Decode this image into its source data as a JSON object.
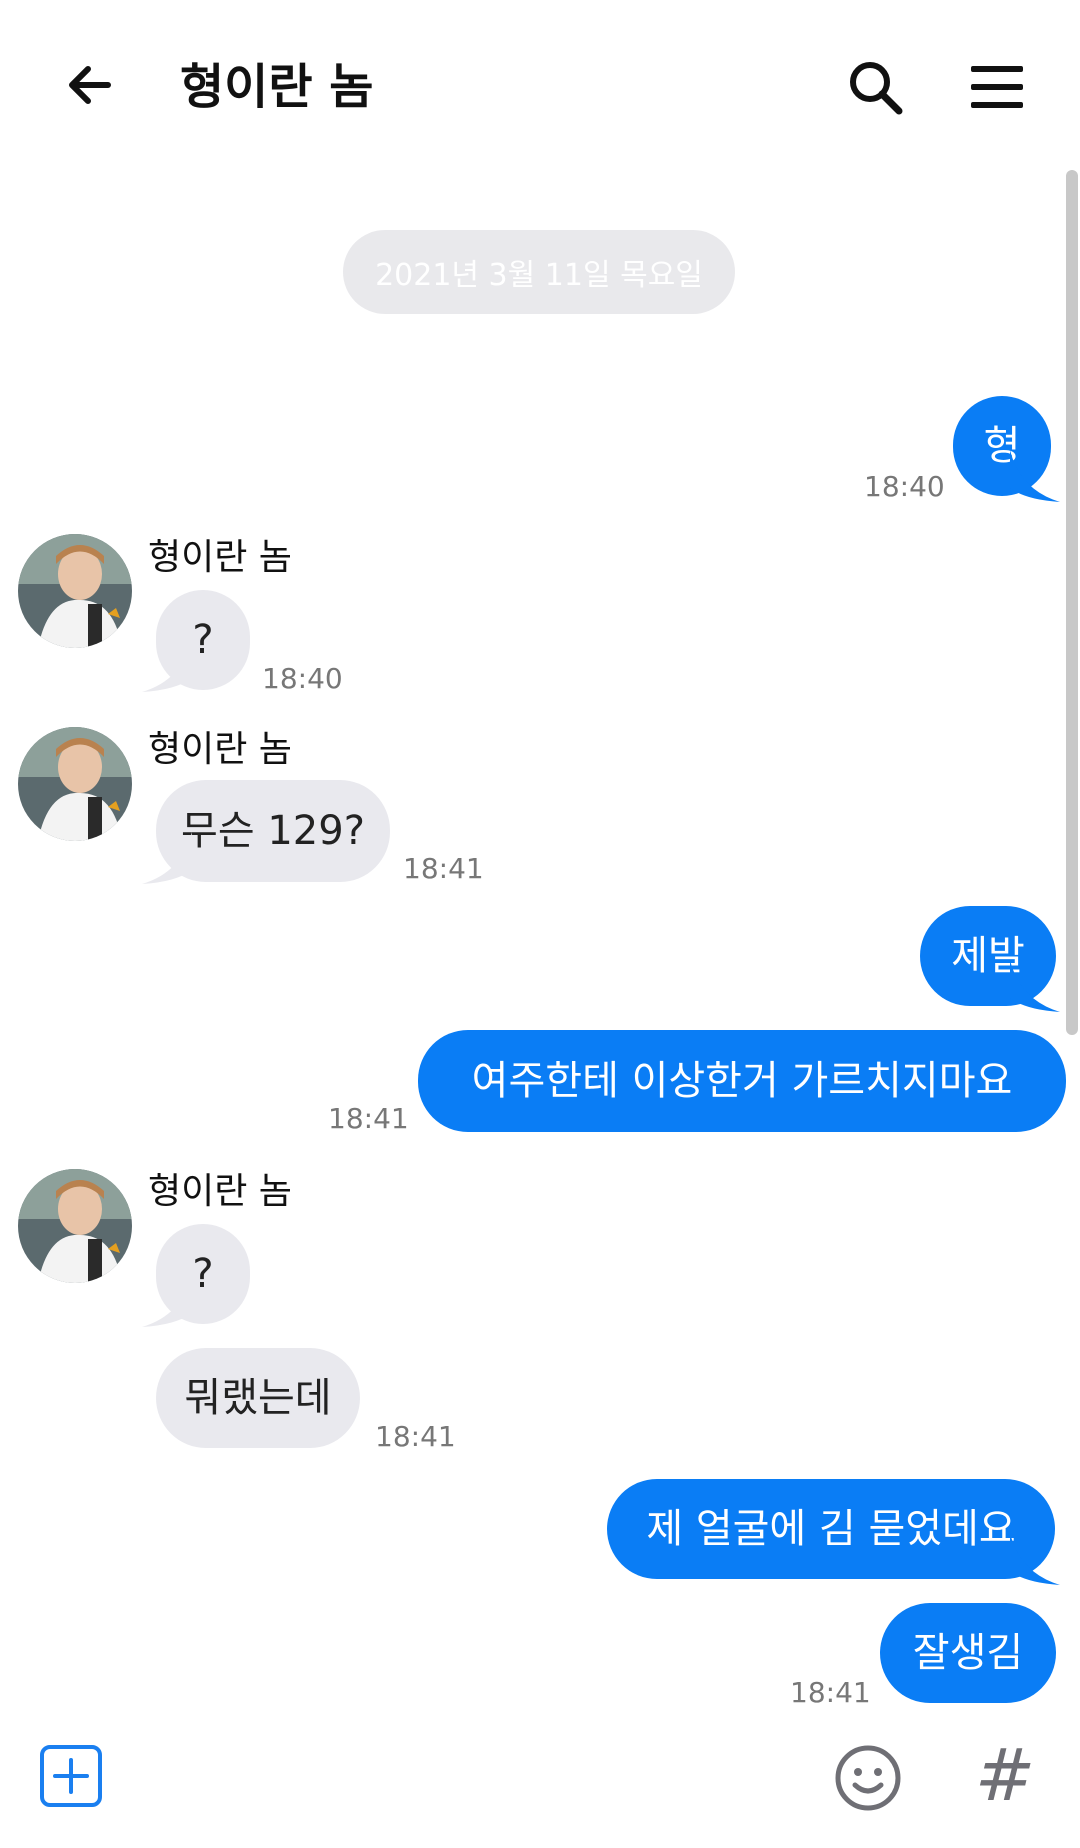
{
  "header": {
    "title": "형이란 놈"
  },
  "date_divider": "2021년 3월 11일 목요일",
  "messages": [
    {
      "text": "형",
      "time": "18:40"
    },
    {
      "sender": "형이란 놈",
      "text": "?",
      "time": "18:40"
    },
    {
      "sender": "형이란 놈",
      "text": "무슨 129?",
      "time": "18:41"
    },
    {
      "text": "제발"
    },
    {
      "text": "여주한테 이상한거 가르치지마요",
      "time": "18:41"
    },
    {
      "sender": "형이란 놈",
      "text": "?"
    },
    {
      "text": "뭐랬는데",
      "time": "18:41"
    },
    {
      "text": "제 얼굴에 김 묻었데요"
    },
    {
      "text": "잘생김",
      "time": "18:41"
    }
  ],
  "bottom": {
    "hash_label": "#"
  },
  "colors": {
    "outgoing_bubble": "#0a7df5",
    "incoming_bubble": "#e9e9ee",
    "accent": "#1a7ff0"
  }
}
